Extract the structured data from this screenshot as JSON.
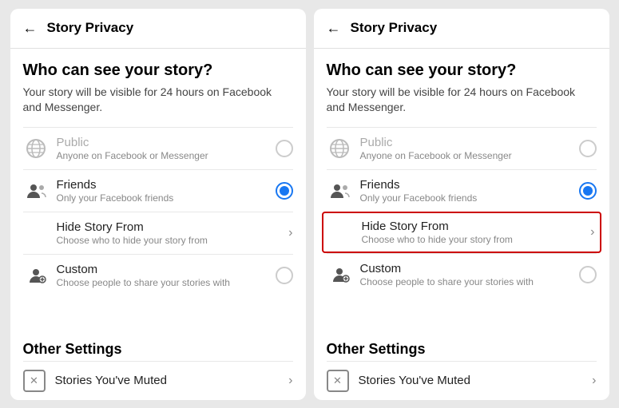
{
  "panels": [
    {
      "id": "left",
      "header": {
        "back_label": "←",
        "title": "Story Privacy"
      },
      "who_section": {
        "title": "Who can see your story?",
        "description": "Your story will be visible for 24 hours on Facebook and Messenger."
      },
      "options": [
        {
          "id": "public",
          "label": "Public",
          "sublabel": "Anyone on Facebook or Messenger",
          "type": "radio",
          "selected": false,
          "disabled": true,
          "icon": "globe-icon"
        },
        {
          "id": "friends",
          "label": "Friends",
          "sublabel": "Only your Facebook friends",
          "type": "radio",
          "selected": true,
          "disabled": false,
          "icon": "friends-icon"
        },
        {
          "id": "hide-story",
          "label": "Hide Story From",
          "sublabel": "Choose who to hide your story from",
          "type": "chevron",
          "selected": false,
          "disabled": false,
          "highlighted": false,
          "icon": "none"
        },
        {
          "id": "custom",
          "label": "Custom",
          "sublabel": "Choose people to share your stories with",
          "type": "radio",
          "selected": false,
          "disabled": false,
          "icon": "custom-icon"
        }
      ],
      "other_settings": {
        "title": "Other Settings",
        "items": [
          {
            "id": "muted-stories",
            "label": "Stories You've Muted",
            "icon": "mute-icon",
            "type": "chevron"
          }
        ]
      }
    },
    {
      "id": "right",
      "header": {
        "back_label": "←",
        "title": "Story Privacy"
      },
      "who_section": {
        "title": "Who can see your story?",
        "description": "Your story will be visible for 24 hours on Facebook and Messenger."
      },
      "options": [
        {
          "id": "public",
          "label": "Public",
          "sublabel": "Anyone on Facebook or Messenger",
          "type": "radio",
          "selected": false,
          "disabled": true,
          "icon": "globe-icon"
        },
        {
          "id": "friends",
          "label": "Friends",
          "sublabel": "Only your Facebook friends",
          "type": "radio",
          "selected": true,
          "disabled": false,
          "icon": "friends-icon"
        },
        {
          "id": "hide-story",
          "label": "Hide Story From",
          "sublabel": "Choose who to hide your story from",
          "type": "chevron",
          "selected": false,
          "disabled": false,
          "highlighted": true,
          "icon": "none"
        },
        {
          "id": "custom",
          "label": "Custom",
          "sublabel": "Choose people to share your stories with",
          "type": "radio",
          "selected": false,
          "disabled": false,
          "icon": "custom-icon"
        }
      ],
      "other_settings": {
        "title": "Other Settings",
        "items": [
          {
            "id": "muted-stories",
            "label": "Stories You've Muted",
            "icon": "mute-icon",
            "type": "chevron"
          }
        ]
      }
    }
  ]
}
